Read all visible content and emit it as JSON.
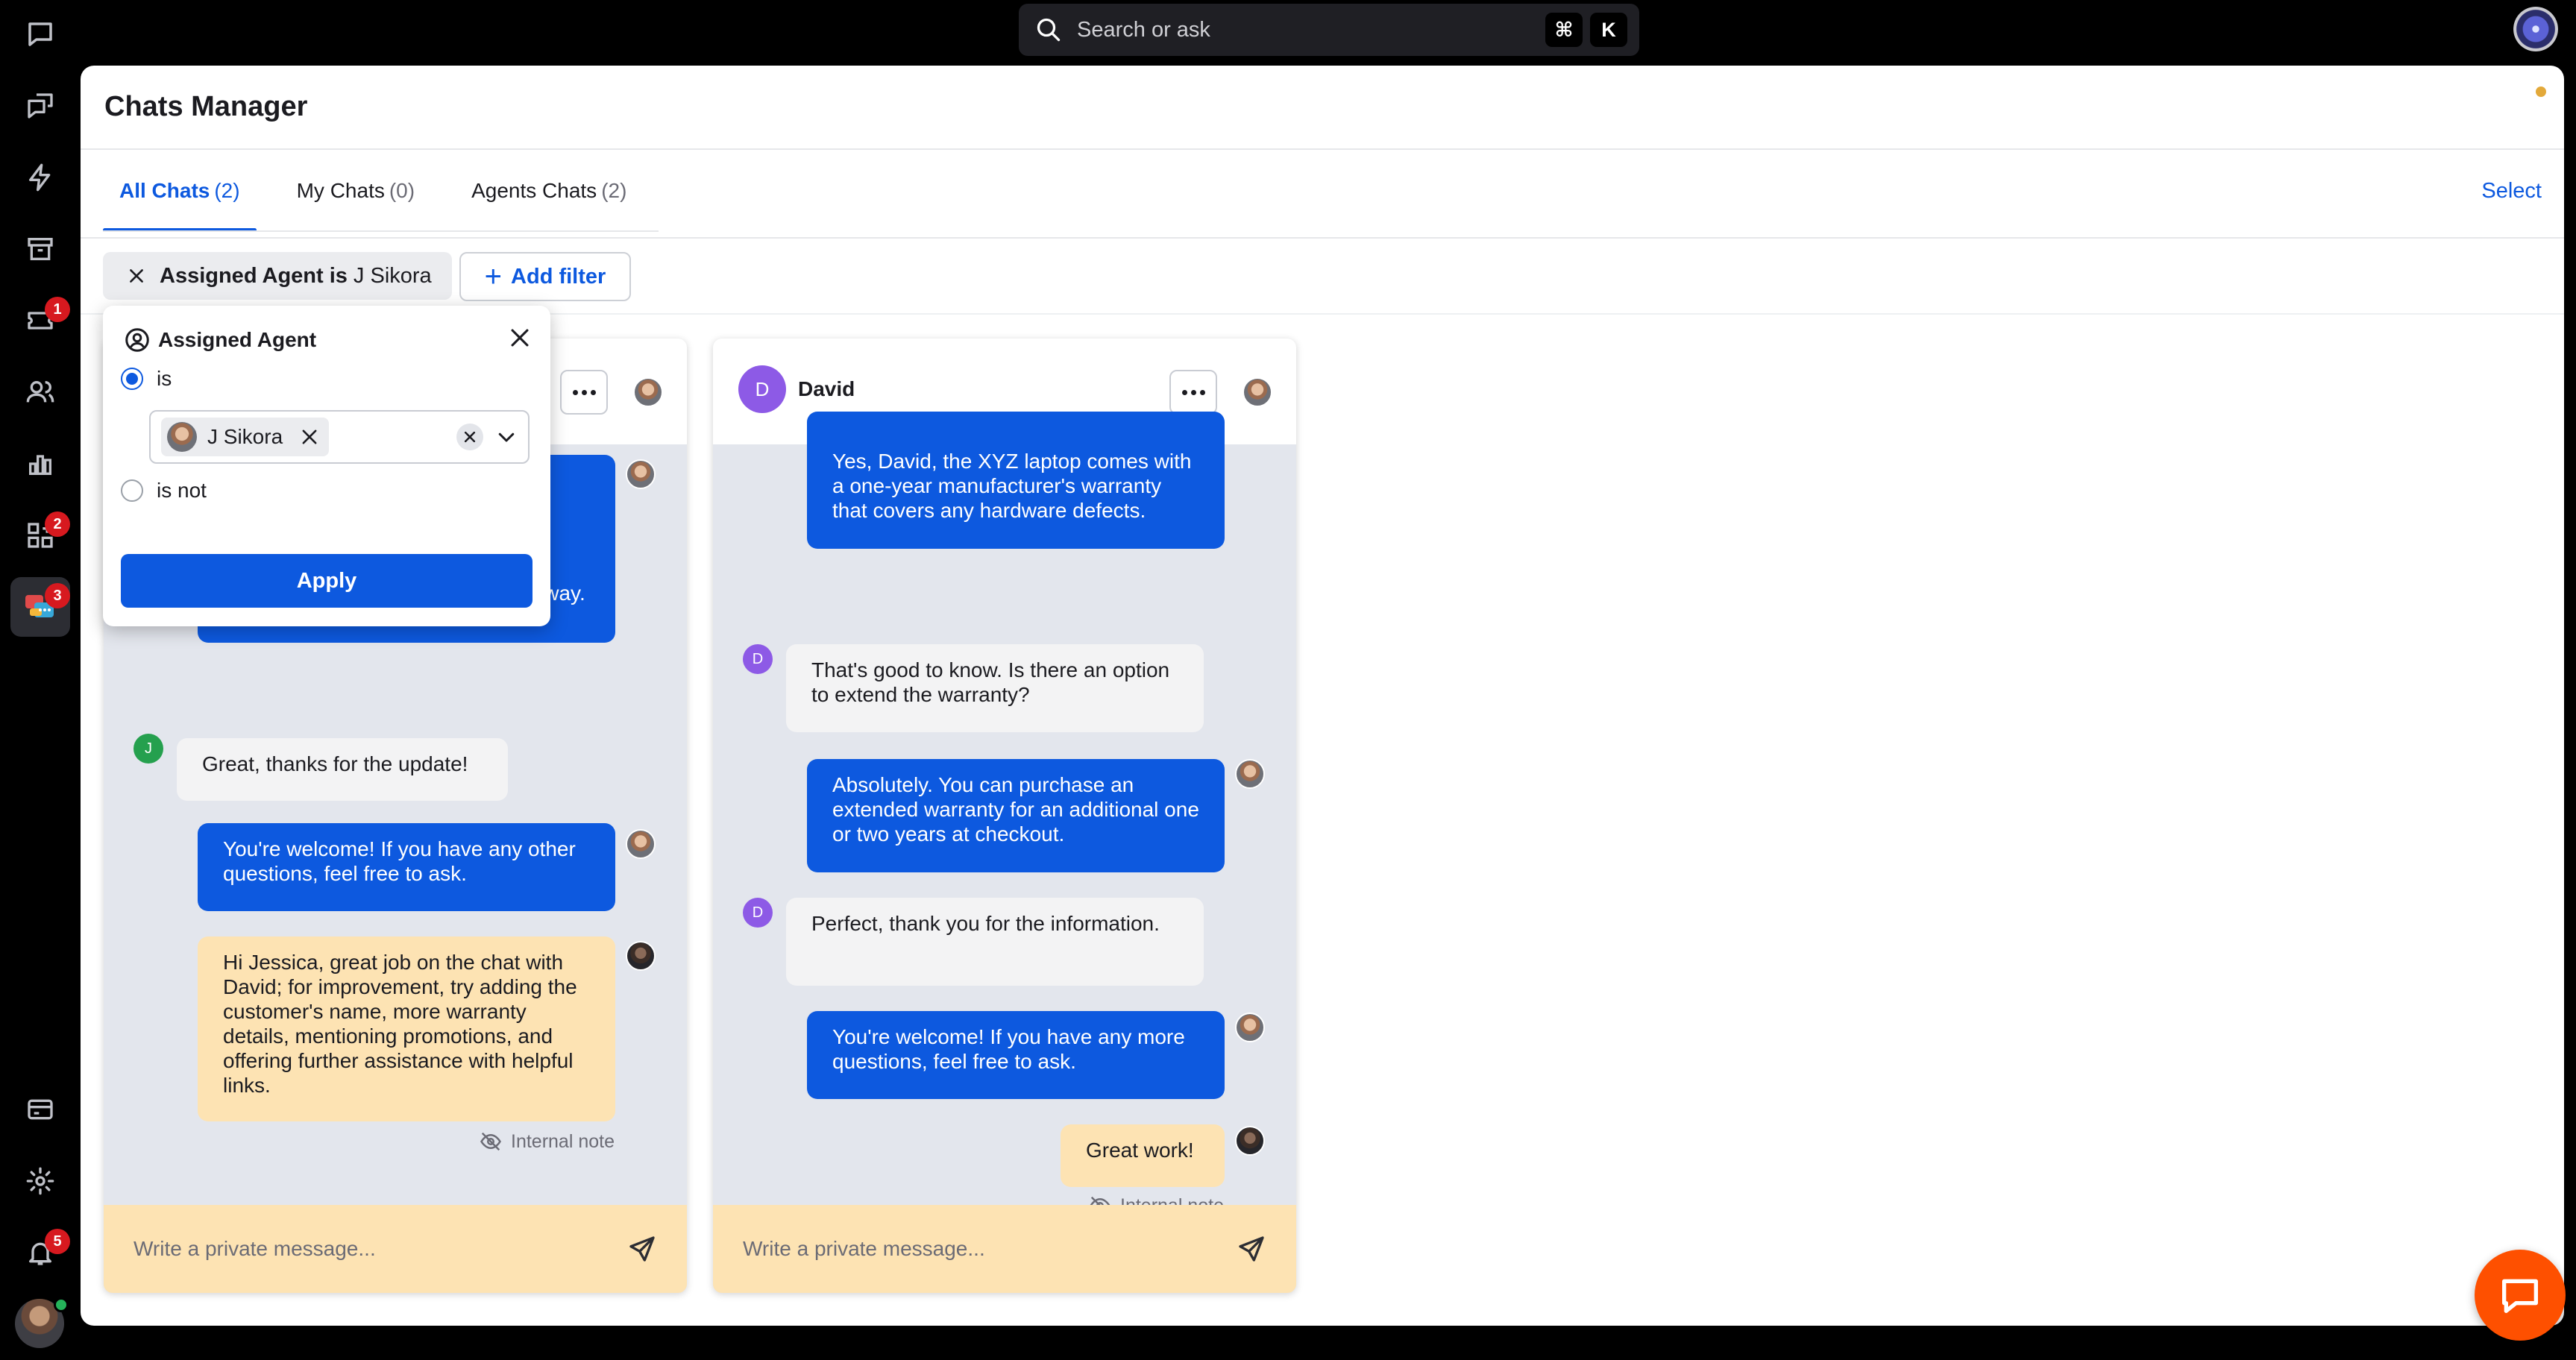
{
  "search": {
    "placeholder": "Search or ask",
    "shortcut_mod": "⌘",
    "shortcut_key": "K"
  },
  "rail": {
    "items": [
      {
        "icon": "chats-icon",
        "badge": ""
      },
      {
        "icon": "engage-icon",
        "badge": ""
      },
      {
        "icon": "automation-icon",
        "badge": ""
      },
      {
        "icon": "archive-icon",
        "badge": ""
      },
      {
        "icon": "tickets-icon",
        "badge": "1"
      },
      {
        "icon": "team-icon",
        "badge": ""
      },
      {
        "icon": "reports-icon",
        "badge": ""
      },
      {
        "icon": "apps-icon",
        "badge": "2"
      },
      {
        "icon": "chats-manager-icon",
        "badge": "3"
      },
      {
        "icon": "billing-icon",
        "badge": ""
      },
      {
        "icon": "settings-icon",
        "badge": ""
      },
      {
        "icon": "notifications-icon",
        "badge": "5"
      }
    ]
  },
  "page": {
    "title": "Chats Manager",
    "select_label": "Select"
  },
  "tabs": [
    {
      "label": "All Chats",
      "count": "(2)"
    },
    {
      "label": "My Chats",
      "count": "(0)"
    },
    {
      "label": "Agents Chats",
      "count": "(2)"
    }
  ],
  "filter": {
    "chip_key": "Assigned Agent is",
    "chip_value": "J Sikora",
    "add_label": "Add filter"
  },
  "popover": {
    "title": "Assigned Agent",
    "option_is": "is",
    "option_is_not": "is not",
    "selected_agent": "J Sikora",
    "apply_label": "Apply"
  },
  "chat1": {
    "messages": [
      {
        "type": "agent",
        "text": "next 2 days. You'll receive a confirmation email once it's on the way."
      },
      {
        "type": "customer",
        "initial": "J",
        "text": "Great, thanks for the update!"
      },
      {
        "type": "agent",
        "text": "You're welcome! If you have any other questions, feel free to ask."
      },
      {
        "type": "note",
        "text": "Hi Jessica, great job on the chat with David; for improvement, try adding the customer's name, more warranty details, mentioning promotions, and offering further assistance with helpful links."
      }
    ],
    "internal_note_label": "Internal note",
    "composer_placeholder": "Write a private message..."
  },
  "chat2": {
    "initial": "D",
    "name": "David",
    "messages": [
      {
        "type": "agent",
        "text": "Yes, David, the XYZ laptop comes with a one-year manufacturer's warranty that covers any hardware defects."
      },
      {
        "type": "customer",
        "initial": "D",
        "text": "That's good to know. Is there an option to extend the warranty?"
      },
      {
        "type": "agent",
        "text": "Absolutely. You can purchase an extended warranty for an additional one or two years at checkout."
      },
      {
        "type": "customer",
        "initial": "D",
        "text": "Perfect, thank you for the information."
      },
      {
        "type": "agent",
        "text": "You're welcome! If you have any more questions, feel free to ask."
      },
      {
        "type": "note",
        "text": "Great work!"
      }
    ],
    "internal_note_label": "Internal note",
    "composer_placeholder": "Write a private message..."
  },
  "colors": {
    "accent": "#0d59df",
    "note": "#fde3b3",
    "badge": "#d7191f",
    "launcher": "#fe5000"
  }
}
